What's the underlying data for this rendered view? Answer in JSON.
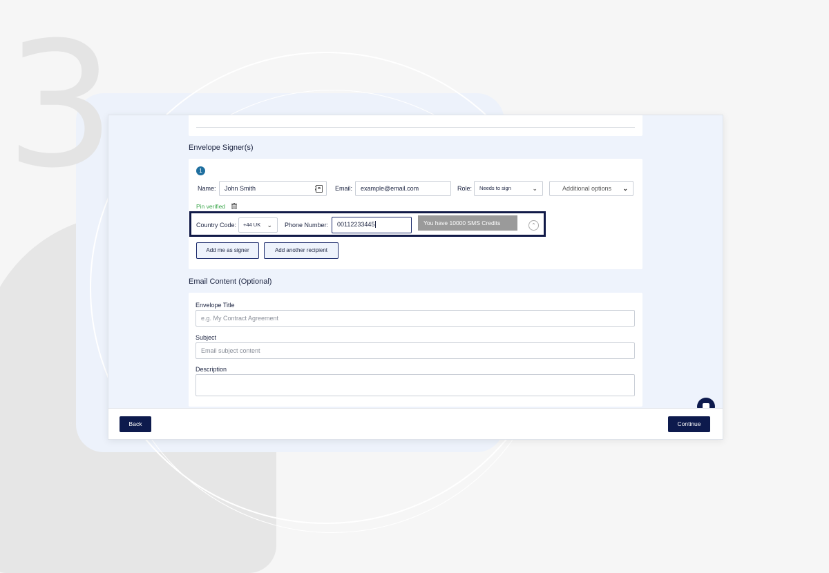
{
  "step_number": "3",
  "signers": {
    "title": "Envelope Signer(s)",
    "index": "1",
    "name_label": "Name:",
    "name_value": "John Smith",
    "email_label": "Email:",
    "email_value": "example@email.com",
    "role_label": "Role:",
    "role_value": "Needs to sign",
    "additional_options": "Additional options",
    "pin_status": "Pin verified",
    "country_code_label": "Country Code:",
    "country_code_value": "+44 UK",
    "phone_label": "Phone Number:",
    "phone_value": "00112233445",
    "sms_tooltip": "You have 10000 SMS Credits",
    "add_me_button": "Add me as signer",
    "add_recipient_button": "Add another recipient"
  },
  "email_content": {
    "title": "Email Content (Optional)",
    "envelope_title_label": "Envelope Title",
    "envelope_title_placeholder": "e.g. My Contract Agreement",
    "subject_label": "Subject",
    "subject_placeholder": "Email subject content",
    "description_label": "Description"
  },
  "footer": {
    "back_label": "Back",
    "continue_label": "Continue"
  },
  "colors": {
    "primary": "#0d1a4d",
    "pin_verified": "#3aa64a",
    "badge": "#1f6f9f",
    "tooltip": "#9a9a9a"
  }
}
